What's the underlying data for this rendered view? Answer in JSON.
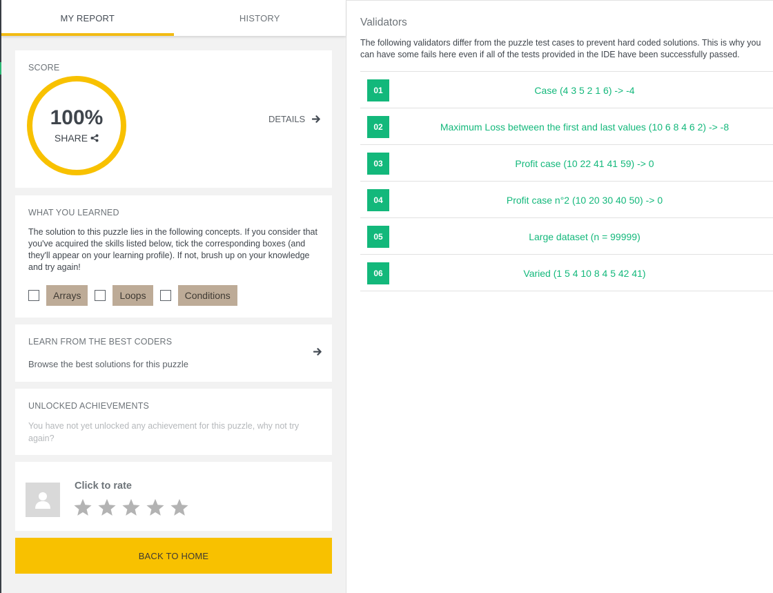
{
  "tabs": [
    {
      "label": "MY REPORT",
      "active": true
    },
    {
      "label": "HISTORY",
      "active": false
    }
  ],
  "score": {
    "title": "SCORE",
    "value": "100%",
    "share_label": "SHARE",
    "details_label": "DETAILS"
  },
  "learned": {
    "title": "WHAT YOU LEARNED",
    "description": "The solution to this puzzle lies in the following concepts. If you consider that you've acquired the skills listed below, tick the corresponding boxes (and they'll appear on your learning profile). If not, brush up on your knowledge and try again!",
    "skills": [
      "Arrays",
      "Loops",
      "Conditions"
    ]
  },
  "learn_from": {
    "title": "LEARN FROM THE BEST CODERS",
    "subtitle": "Browse the best solutions for this puzzle"
  },
  "achievements": {
    "title": "UNLOCKED ACHIEVEMENTS",
    "text": "You have not yet unlocked any achievement for this puzzle, why not try again?"
  },
  "rating": {
    "label": "Click to rate",
    "stars": 5,
    "value": 0
  },
  "home_button": "BACK TO HOME",
  "validators": {
    "title": "Validators",
    "description": "The following validators differ from the puzzle test cases to prevent hard coded solutions. This is why you can have some fails here even if all of the tests provided in the IDE have been successfully passed.",
    "items": [
      {
        "num": "01",
        "label": "Case (4 3 5 2 1 6) -> -4"
      },
      {
        "num": "02",
        "label": "Maximum Loss between the first and last values (10 6 8 4 6 2) -> -8"
      },
      {
        "num": "03",
        "label": "Profit case (10 22 41 41 59) -> 0"
      },
      {
        "num": "04",
        "label": "Profit case n°2 (10 20 30 40 50) -> 0"
      },
      {
        "num": "05",
        "label": "Large dataset (n = 99999)"
      },
      {
        "num": "06",
        "label": "Varied (1 5 4 10 8 4 5 42 41)"
      }
    ]
  },
  "colors": {
    "accent": "#f8c100",
    "success": "#13b87b",
    "skill_tag": "#bdab97"
  }
}
